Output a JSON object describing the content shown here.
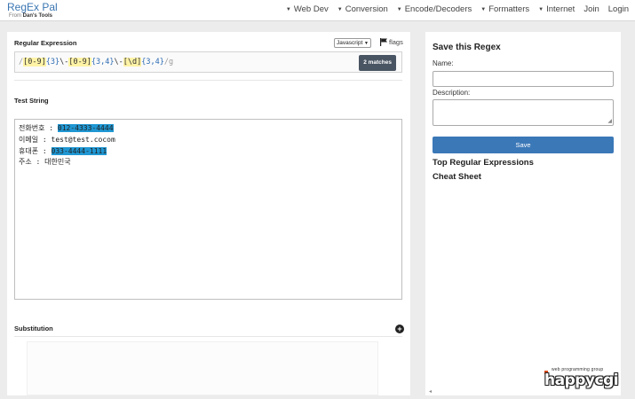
{
  "brand": {
    "title": "RegEx Pal",
    "sub_prefix": "From",
    "sub_name": "Dan's Tools"
  },
  "nav": [
    {
      "label": "Web Dev",
      "has_caret": true
    },
    {
      "label": "Conversion",
      "has_caret": true
    },
    {
      "label": "Encode/Decoders",
      "has_caret": true
    },
    {
      "label": "Formatters",
      "has_caret": true
    },
    {
      "label": "Internet",
      "has_caret": true
    },
    {
      "label": "Join",
      "has_caret": false
    },
    {
      "label": "Login",
      "has_caret": false
    }
  ],
  "regex_section": {
    "label": "Regular Expression",
    "language": "Javascript",
    "flags_label": "flags",
    "match_count": "2 matches",
    "tokens": [
      {
        "text": "/",
        "type": "slash"
      },
      {
        "text": "[0-9]",
        "type": "hl"
      },
      {
        "text": "{3}",
        "type": "q"
      },
      {
        "text": "\\-",
        "type": "esc"
      },
      {
        "text": "[0-9]",
        "type": "hl"
      },
      {
        "text": "{3,4}",
        "type": "q"
      },
      {
        "text": "\\-",
        "type": "esc"
      },
      {
        "text": "[\\d]",
        "type": "hl"
      },
      {
        "text": "{3,4}",
        "type": "q"
      },
      {
        "text": "/g",
        "type": "slash"
      }
    ]
  },
  "test_section": {
    "label": "Test String",
    "lines": [
      {
        "prefix": "전화번호 : ",
        "match": "012-4333-4444",
        "suffix": ""
      },
      {
        "prefix": "이메일 : test@test.cocom",
        "match": "",
        "suffix": ""
      },
      {
        "prefix": "휴대폰 : ",
        "match": "033-4444-1111",
        "suffix": ""
      },
      {
        "prefix": "주소 : 대한민국",
        "match": "",
        "suffix": ""
      }
    ]
  },
  "substitution": {
    "label": "Substitution"
  },
  "save_panel": {
    "title": "Save this Regex",
    "name_label": "Name:",
    "description_label": "Description:",
    "save_label": "Save",
    "top_regex_label": "Top Regular Expressions",
    "cheat_sheet_label": "Cheat Sheet"
  },
  "watermark": {
    "small": "web programming group",
    "main": "happycgi"
  },
  "colors": {
    "accent": "#3b78b8",
    "match_highlight": "#1f97d3",
    "regex_class_highlight": "#fff3a6",
    "badge": "#4a5563"
  }
}
